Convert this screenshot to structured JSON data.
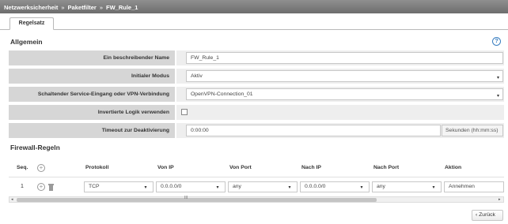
{
  "breadcrumb": {
    "part1": "Netzwerksicherheit",
    "sep1": "»",
    "part2": "Paketfilter",
    "sep2": "»",
    "part3": "FW_Rule_1"
  },
  "tabs": {
    "active": "Regelsatz"
  },
  "general": {
    "title": "Allgemein",
    "help_icon": "?",
    "rows": [
      {
        "label": "Ein beschreibender Name",
        "value": "FW_Rule_1"
      },
      {
        "label": "Initialer Modus",
        "value": "Aktiv"
      },
      {
        "label": "Schaltender Service-Eingang oder VPN-Verbindung",
        "value": "OpenVPN-Connection_01"
      },
      {
        "label": "Invertierte Logik verwenden",
        "value": ""
      },
      {
        "label": "Timeout zur Deaktivierung",
        "value": "0:00:00",
        "suffix": "Sekunden (hh:mm:ss)"
      }
    ]
  },
  "firewall": {
    "title": "Firewall-Regeln",
    "columns": {
      "seq": "Seq.",
      "protocol": "Protokoll",
      "from_ip": "Von IP",
      "from_port": "Von Port",
      "to_ip": "Nach IP",
      "to_port": "Nach Port",
      "action": "Aktion"
    },
    "rows": [
      {
        "seq": "1",
        "protocol": "TCP",
        "from_ip": "0.0.0.0/0",
        "from_port": "any",
        "to_ip": "0.0.0.0/0",
        "to_port": "any",
        "action": "Annehmen"
      }
    ],
    "scroll_grip": "III"
  },
  "footer": {
    "back_label": "Zurück"
  },
  "glyphs": {
    "caret": "▾",
    "plus": "+",
    "left_arrow": "◂",
    "right_arrow": "▸",
    "back_chevron": "‹"
  },
  "colors": {
    "titlebar": "#7d7d7d",
    "label_bg": "#d6d6d6",
    "field_bg": "#eeeeee",
    "help": "#3a7fc1"
  }
}
